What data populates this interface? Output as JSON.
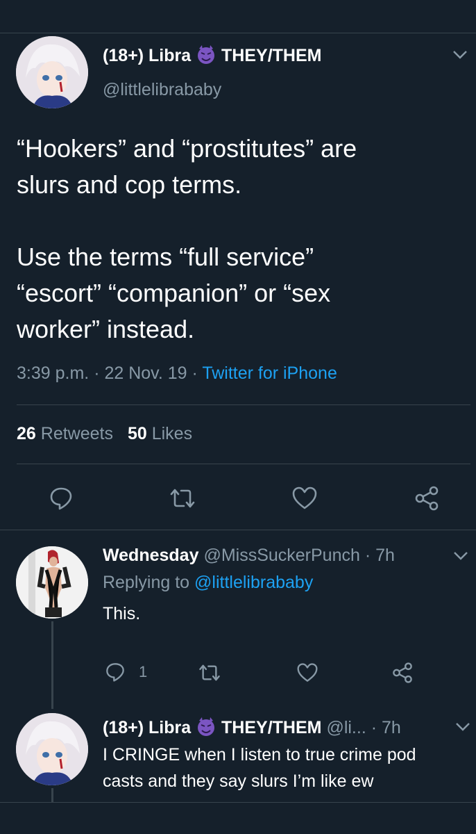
{
  "main_tweet": {
    "display_name_pre": "(18+) Libra",
    "display_name_post": "THEY/THEM",
    "handle": "@littlelibrababy",
    "body_lines": [
      "“Hookers” and “prostitutes” are",
      "slurs and cop terms.",
      "",
      "Use the terms “full service”",
      "“escort” “companion” or “sex",
      "worker” instead."
    ],
    "time": "3:39 p.m.",
    "date": "22 Nov. 19",
    "source": "Twitter for iPhone",
    "sep": "·",
    "retweets_count": "26",
    "retweets_label": "Retweets",
    "likes_count": "50",
    "likes_label": "Likes"
  },
  "reply1": {
    "display_name": "Wednesday",
    "handle": "@MissSuckerPunch",
    "time": "· 7h",
    "replying_prefix": "Replying to",
    "replying_handle": "@littlelibrababy",
    "text": "This.",
    "reply_count": "1"
  },
  "reply2": {
    "display_name_pre": "(18+) Libra",
    "display_name_post": "THEY/THEM",
    "handle": "@li...",
    "time": "· 7h",
    "text_lines": [
      "I CRINGE when I listen to true crime pod",
      "casts and they say slurs I’m like ew"
    ]
  },
  "colors": {
    "background": "#15202b",
    "muted": "#8899a6",
    "link": "#1da1f2",
    "divider": "#38444d",
    "emoji": "#7b55c2"
  },
  "icons": [
    "chevron-down-icon",
    "reply-icon",
    "retweet-icon",
    "like-icon",
    "share-icon",
    "devil-emoji-icon"
  ]
}
